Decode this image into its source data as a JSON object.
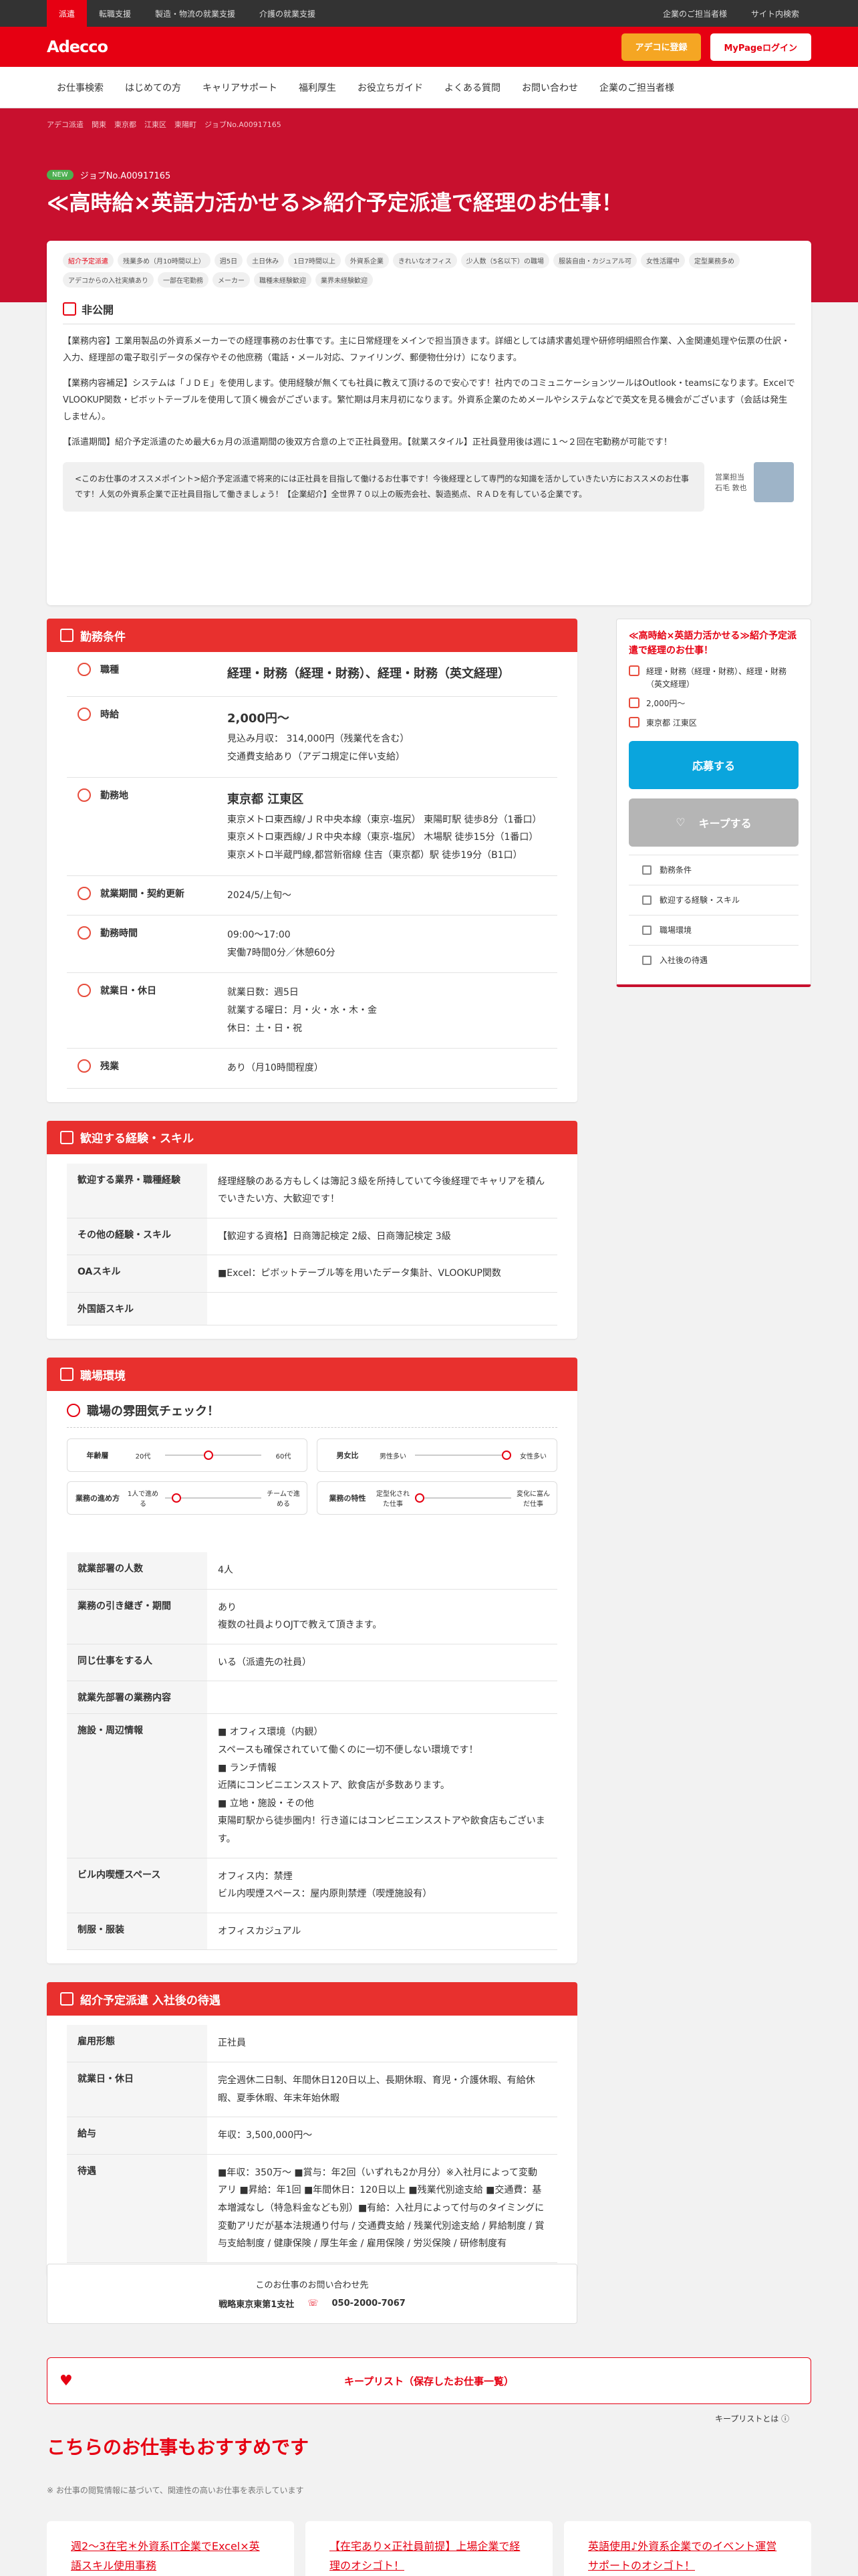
{
  "topbar": {
    "items": [
      "派遣",
      "転職支援",
      "製造・物流の就業支援",
      "介護の就業支援"
    ],
    "right": [
      "企業のご担当者様",
      "サイト内検索"
    ]
  },
  "header": {
    "logo": "Adecco",
    "register": "アデコに登録",
    "mypage": "MyPageログイン"
  },
  "nav": [
    "お仕事検索",
    "はじめての方",
    "キャリアサポート",
    "福利厚生",
    "お役立ちガイド",
    "よくある質問",
    "お問い合わせ",
    "企業のご担当者様"
  ],
  "breadcrumb": [
    "アデコ派遣",
    "関東",
    "東京都",
    "江東区",
    "東陽町",
    "ジョブNo.A00917165"
  ],
  "job": {
    "new": "NEW",
    "no": "ジョブNo.A00917165",
    "title": "≪高時給×英語力活かせる≫紹介予定派遣で経理のお仕事！"
  },
  "tags": [
    "紹介予定派遣",
    "残業多め（月10時間以上）",
    "週5日",
    "土日休み",
    "1日7時間以上",
    "外資系企業",
    "きれいなオフィス",
    "少人数（5名以下）の職場",
    "服装自由・カジュアル可",
    "女性活躍中",
    "定型業務多め",
    "アデコからの入社実績あり",
    "一部在宅勤務",
    "メーカー",
    "職種未経験歓迎",
    "業界未経験歓迎"
  ],
  "detail": {
    "heading": "非公開",
    "p1": "【業務内容】工業用製品の外資系メーカーでの経理事務のお仕事です。主に日常経理をメインで担当頂きます。詳細としては請求書処理や研修明細照合作業、入金関連処理や伝票の仕訳・入力、経理部の電子取引データの保存やその他庶務（電話・メール対応、ファイリング、郵便物仕分け）になります。",
    "p2": "【業務内容補足】システムは「ＪＤＥ」を使用します。使用経験が無くても社員に教えて頂けるので安心です！社内でのコミュニケーションツールはOutlook・teamsになります。ExcelでVLOOKUP関数・ピボットテーブルを使用して頂く機会がございます。繁忙期は月末月初になります。外資系企業のためメールやシステムなどで英文を見る機会がございます（会話は発生しません）。",
    "p3": "【派遣期間】紹介予定派遣のため最大6ヵ月の派遣期間の後双方合意の上で正社員登用。【就業スタイル】正社員登用後は週に１～２回在宅勤務が可能です！",
    "quote": "<このお仕事のオススメポイント>紹介予定派遣で将来的には正社員を目指して働けるお仕事です！今後経理として専門的な知識を活かしていきたい方におススメのお仕事です！人気の外資系企業で正社員目指して働きましょう！【企業紹介】全世界７０以上の販売会社、製造拠点、ＲＡＤを有している企業です。",
    "staff_role": "営業担当",
    "staff_name": "石毛 敦也"
  },
  "conditions": {
    "title": "勤務条件",
    "rows": [
      {
        "k": "職種",
        "main": "経理・財務（経理・財務）、経理・財務（英文経理）",
        "sub": ""
      },
      {
        "k": "時給",
        "main": "2,000円〜",
        "sub": "見込み月収： 314,000円（残業代を含む）\n交通費支給あり（アデコ規定に伴い支給）"
      },
      {
        "k": "勤務地",
        "main": "東京都 江東区",
        "sub": "東京メトロ東西線/ＪＲ中央本線（東京-塩尻） 東陽町駅 徒歩8分（1番口）\n東京メトロ東西線/ＪＲ中央本線（東京-塩尻） 木場駅 徒歩15分（1番口）\n東京メトロ半蔵門線,都営新宿線 住吉（東京都）駅 徒歩19分（B1口）"
      },
      {
        "k": "就業期間・契約更新",
        "main": "",
        "sub": "2024/5/上旬〜"
      },
      {
        "k": "勤務時間",
        "main": "",
        "sub": "09:00〜17:00\n実働7時間0分／休憩60分"
      },
      {
        "k": "就業日・休日",
        "main": "",
        "sub": "就業日数：週5日\n就業する曜日：月・火・水・木・金\n休日：土・日・祝"
      },
      {
        "k": "残業",
        "main": "",
        "sub": "あり（月10時間程度）"
      }
    ]
  },
  "skills": {
    "title": "歓迎する経験・スキル",
    "rows": [
      {
        "k": "歓迎する業界・職種経験",
        "v": "経理経験のある方もしくは簿記３級を所持していて今後経理でキャリアを積んでいきたい方、大歓迎です！"
      },
      {
        "k": "その他の経験・スキル",
        "v": "【歓迎する資格】日商簿記検定 2級、日商簿記検定 3級"
      },
      {
        "k": "OAスキル",
        "v": "■Excel：ピボットテーブル等を用いたデータ集計、VLOOKUP関数"
      },
      {
        "k": "外国語スキル",
        "v": ""
      }
    ]
  },
  "env": {
    "title": "職場環境",
    "atm_title": "職場の雰囲気チェック！",
    "atm": [
      {
        "label": "年齢層",
        "left": "20代",
        "right": "60代",
        "pos": 0.45
      },
      {
        "label": "男女比",
        "left": "男性多い",
        "right": "女性多い",
        "pos": 0.95
      },
      {
        "label": "業務の進め方",
        "left": "1人で進める",
        "right": "チームで進める",
        "pos": 0.12
      },
      {
        "label": "業務の特性",
        "left": "定型化された仕事",
        "right": "変化に富んだ仕事",
        "pos": 0.05
      }
    ],
    "rows": [
      {
        "k": "就業部署の人数",
        "v": "4人"
      },
      {
        "k": "業務の引き継ぎ・期間",
        "v": "あり\n複数の社員よりOJTで教えて頂きます。"
      },
      {
        "k": "同じ仕事をする人",
        "v": "いる（派遣先の社員）"
      },
      {
        "k": "就業先部署の業務内容",
        "v": ""
      },
      {
        "k": "施設・周辺情報",
        "v": "■ オフィス環境（内観）\nスペースも確保されていて働くのに一切不便しない環境です！\n■ ランチ情報\n近隣にコンビニエンスストア、飲食店が多数あります。\n■ 立地・施設・その他\n東陽町駅から徒歩圏内！行き道にはコンビニエンスストアや飲食店もございます。"
      },
      {
        "k": "ビル内喫煙スペース",
        "v": "オフィス内：禁煙\nビル内喫煙スペース：屋内原則禁煙（喫煙施設有）"
      },
      {
        "k": "制服・服装",
        "v": "オフィスカジュアル"
      }
    ]
  },
  "after": {
    "title": "紹介予定派遣 入社後の待遇",
    "rows": [
      {
        "k": "雇用形態",
        "v": "正社員"
      },
      {
        "k": "就業日・休日",
        "v": "完全週休二日制、年間休日120日以上、長期休暇、育児・介護休暇、有給休暇、夏季休暇、年末年始休暇"
      },
      {
        "k": "給与",
        "v": "年収：3,500,000円〜"
      },
      {
        "k": "待遇",
        "v": "■年収：350万〜 ■賞与：年2回（いずれも2か月分）※入社月によって変動アリ ■昇給：年1回 ■年間休日：120日以上 ■残業代別途支給 ■交通費：基本増減なし（特急料金なども別）■有給：入社月によって付与のタイミングに変動アリだが基本法規通り付与 / 交通費支給 / 残業代別途支給 / 昇給制度 / 賞与支給制度 / 健康保険 / 厚生年金 / 雇用保険 / 労災保険 / 研修制度有"
      }
    ]
  },
  "contact": {
    "label": "このお仕事のお問い合わせ先",
    "branch": "戦略東京東第1支社",
    "tel": "050-2000-7067"
  },
  "keeplist": {
    "label": "キープリスト（保存したお仕事一覧）",
    "note": "キープリストとは"
  },
  "reco": {
    "title": "こちらのお仕事もおすすめです",
    "note": "※ お仕事の閲覧情報に基づいて、関連性の高いお仕事を表示しています",
    "items": [
      "週2〜3在宅＊外資系IT企業でExcel×英語スキル使用事務",
      "【在宅あり×正社員前提】上場企業で経理のオシゴト！",
      "英語使用♪外資系企業でのイベント運営サポートのオシゴト！"
    ]
  },
  "side": {
    "title": "≪高時給×英語力活かせる≫紹介予定派遣で経理のお仕事！",
    "job": "経理・財務（経理・財務）、経理・財務（英文経理）",
    "wage": "2,000円〜",
    "area": "東京都 江東区",
    "apply": "応募する",
    "keep": "キープする",
    "links": [
      "勤務条件",
      "歓迎する経験・スキル",
      "職場環境",
      "入社後の待遇"
    ]
  }
}
